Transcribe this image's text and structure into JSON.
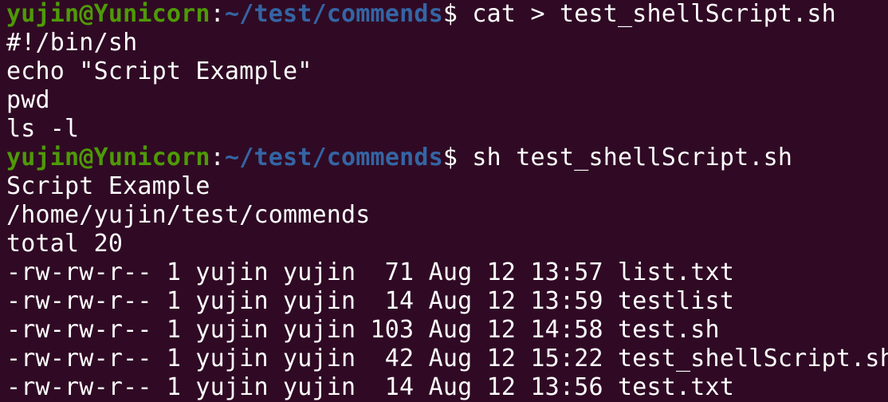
{
  "terminal": {
    "colors": {
      "background": "#300a24",
      "user_host": "#4e9a06",
      "path": "#3465a4",
      "text": "#ffffff"
    },
    "lines": [
      {
        "type": "prompt",
        "user_host": "yujin@Yunicorn",
        "sep": ":",
        "path": "~/test/commends",
        "dollar": "$ ",
        "command": "cat > test_shellScript.sh"
      },
      {
        "type": "output",
        "text": "#!/bin/sh"
      },
      {
        "type": "output",
        "text": "echo \"Script Example\""
      },
      {
        "type": "output",
        "text": "pwd"
      },
      {
        "type": "output",
        "text": "ls -l"
      },
      {
        "type": "prompt",
        "user_host": "yujin@Yunicorn",
        "sep": ":",
        "path": "~/test/commends",
        "dollar": "$ ",
        "command": "sh test_shellScript.sh"
      },
      {
        "type": "output",
        "text": "Script Example"
      },
      {
        "type": "output",
        "text": "/home/yujin/test/commends"
      },
      {
        "type": "output",
        "text": "total 20"
      },
      {
        "type": "output",
        "text": "-rw-rw-r-- 1 yujin yujin  71 Aug 12 13:57 list.txt"
      },
      {
        "type": "output",
        "text": "-rw-rw-r-- 1 yujin yujin  14 Aug 12 13:59 testlist"
      },
      {
        "type": "output",
        "text": "-rw-rw-r-- 1 yujin yujin 103 Aug 12 14:58 test.sh"
      },
      {
        "type": "output",
        "text": "-rw-rw-r-- 1 yujin yujin  42 Aug 12 15:22 test_shellScript.sh"
      },
      {
        "type": "output",
        "text": "-rw-rw-r-- 1 yujin yujin  14 Aug 12 13:56 test.txt"
      }
    ]
  }
}
